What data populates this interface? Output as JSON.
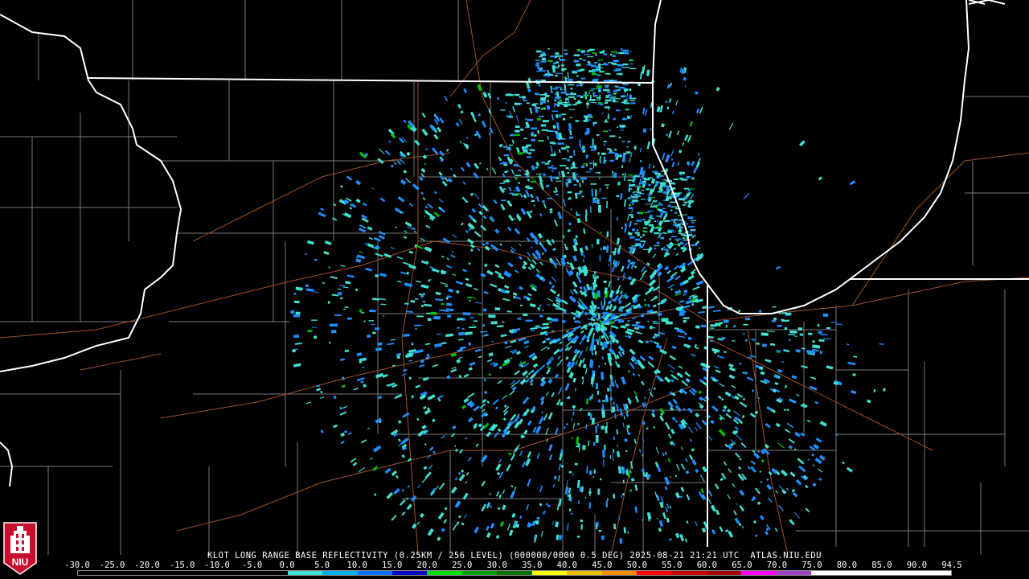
{
  "title": "KLOT LONG RANGE BASE REFLECTIVITY (0.25KM / 256 LEVEL) (000000/0000 0.5 DEG) 2025-08-21 21:21 UTC  ATLAS.NIU.EDU",
  "logo_text": "NIU",
  "scale": {
    "labels": [
      "-30.0",
      "-25.0",
      "-20.0",
      "-15.0",
      "-10.0",
      "-5.0",
      "0.0",
      "5.0",
      "10.0",
      "15.0",
      "20.0",
      "25.0",
      "30.0",
      "35.0",
      "40.0",
      "45.0",
      "50.0",
      "55.0",
      "60.0",
      "65.0",
      "70.0",
      "75.0",
      "80.0",
      "85.0",
      "90.0",
      "94.5"
    ],
    "colors": [
      "#000000",
      "#000000",
      "#000000",
      "#000000",
      "#000000",
      "#000000",
      "#40e0d0",
      "#00b0f0",
      "#0070ff",
      "#0000c8",
      "#00e000",
      "#00a000",
      "#007000",
      "#ffff00",
      "#e8c000",
      "#ff8c00",
      "#ff0000",
      "#c80000",
      "#a00000",
      "#ff00ff",
      "#a040c0",
      "#ffffff",
      "#ffffff",
      "#ffffff",
      "#ffffff"
    ]
  },
  "colors": {
    "background": "#000000",
    "state_border": "#ffffff",
    "county_line": "#808080",
    "road": "#a0522d",
    "echo_light": "#40e0d0",
    "echo_medium": "#1e90ff",
    "echo_strong": "#00c000"
  }
}
